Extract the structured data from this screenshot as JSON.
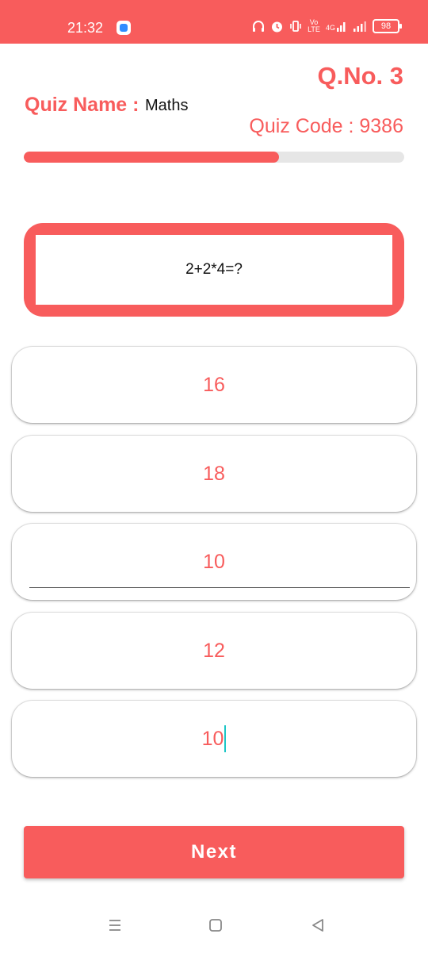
{
  "status_bar": {
    "time": "21:32",
    "network_label": "4G",
    "volte_label": "Vo LTE",
    "battery": "98"
  },
  "header": {
    "question_number": "Q.No. 3",
    "quiz_name_label": "Quiz Name :",
    "quiz_name": "Maths",
    "quiz_code": "Quiz Code : 9386"
  },
  "progress": {
    "value": 0.67
  },
  "question": {
    "text": "2+2*4=?"
  },
  "options": [
    {
      "text": "16"
    },
    {
      "text": "18"
    },
    {
      "text": "10"
    },
    {
      "text": "12"
    },
    {
      "text": "10"
    }
  ],
  "next_label": "Next",
  "colors": {
    "accent": "#F85C5C",
    "track": "#E6E6E6",
    "cursor": "#1CC6C6"
  },
  "icons": {
    "status_bar": [
      "app-notification-icon",
      "headphones-icon",
      "alarm-icon",
      "vibrate-icon",
      "volte-icon",
      "signal-4g-icon",
      "signal-icon",
      "battery-icon"
    ],
    "nav_bar": [
      "recents-menu-icon",
      "home-square-icon",
      "back-triangle-icon"
    ]
  }
}
